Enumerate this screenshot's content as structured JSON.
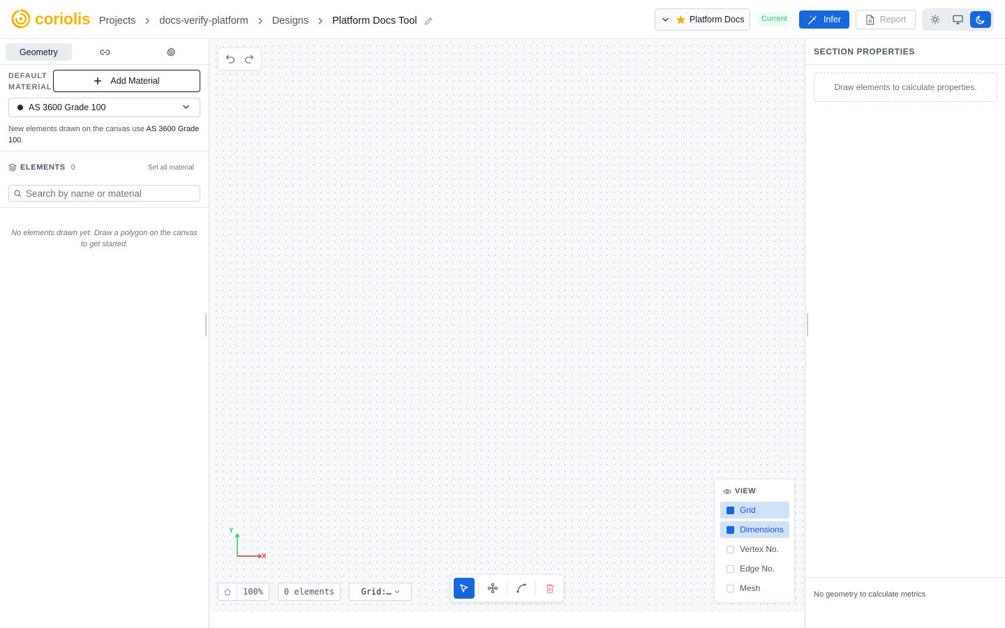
{
  "brand": {
    "name": "coriolis",
    "color": "#f0b40a"
  },
  "breadcrumb": {
    "items": [
      "Projects",
      "docs-verify-platform",
      "Designs"
    ],
    "current": "Platform Docs Tool"
  },
  "header": {
    "version_name": "Platform Docs",
    "version_badge": "Current",
    "infer_label": "Infer",
    "report_label": "Report",
    "accent": "#1668dc",
    "theme_options": [
      "light",
      "system",
      "dark"
    ],
    "theme_selected": "dark"
  },
  "sidebar": {
    "tabs": [
      {
        "label": "Geometry",
        "active": true
      },
      {
        "icon": "link-icon",
        "active": false
      },
      {
        "icon": "gear-icon",
        "active": false
      }
    ],
    "default_material_label": "DEFAULT MATERIAL",
    "add_material_label": "Add Material",
    "selected_material": "AS 3600 Grade 100",
    "hint_prefix": "New elements drawn on the canvas use ",
    "hint_material": "AS 3600 Grade 100",
    "hint_suffix": ".",
    "elements_label": "ELEMENTS",
    "elements_count": "0",
    "set_all_label": "Set all material",
    "search_placeholder": "Search by name or material",
    "empty_message": "No elements drawn yet. Draw a polygon on the canvas to get started."
  },
  "canvas": {
    "axis_x": "X",
    "axis_y": "Y",
    "zoom": "100%",
    "elements_status": "0 elements",
    "grid_label": "Grid:…",
    "tools": [
      {
        "name": "select-tool",
        "icon": "cursor-icon",
        "active": true
      },
      {
        "name": "node-tool",
        "icon": "nodes-icon",
        "active": false
      },
      {
        "name": "curve-tool",
        "icon": "curve-icon",
        "active": false
      },
      {
        "name": "delete-tool",
        "icon": "trash-icon",
        "active": false
      }
    ],
    "view": {
      "title": "VIEW",
      "options": [
        {
          "label": "Grid",
          "checked": true
        },
        {
          "label": "Dimensions",
          "checked": true
        },
        {
          "label": "Vertex No.",
          "checked": false
        },
        {
          "label": "Edge No.",
          "checked": false
        },
        {
          "label": "Mesh",
          "checked": false
        }
      ]
    }
  },
  "properties": {
    "title": "SECTION PROPERTIES",
    "empty_message": "Draw elements to calculate properties.",
    "metrics_message": "No geometry to calculate metrics"
  }
}
